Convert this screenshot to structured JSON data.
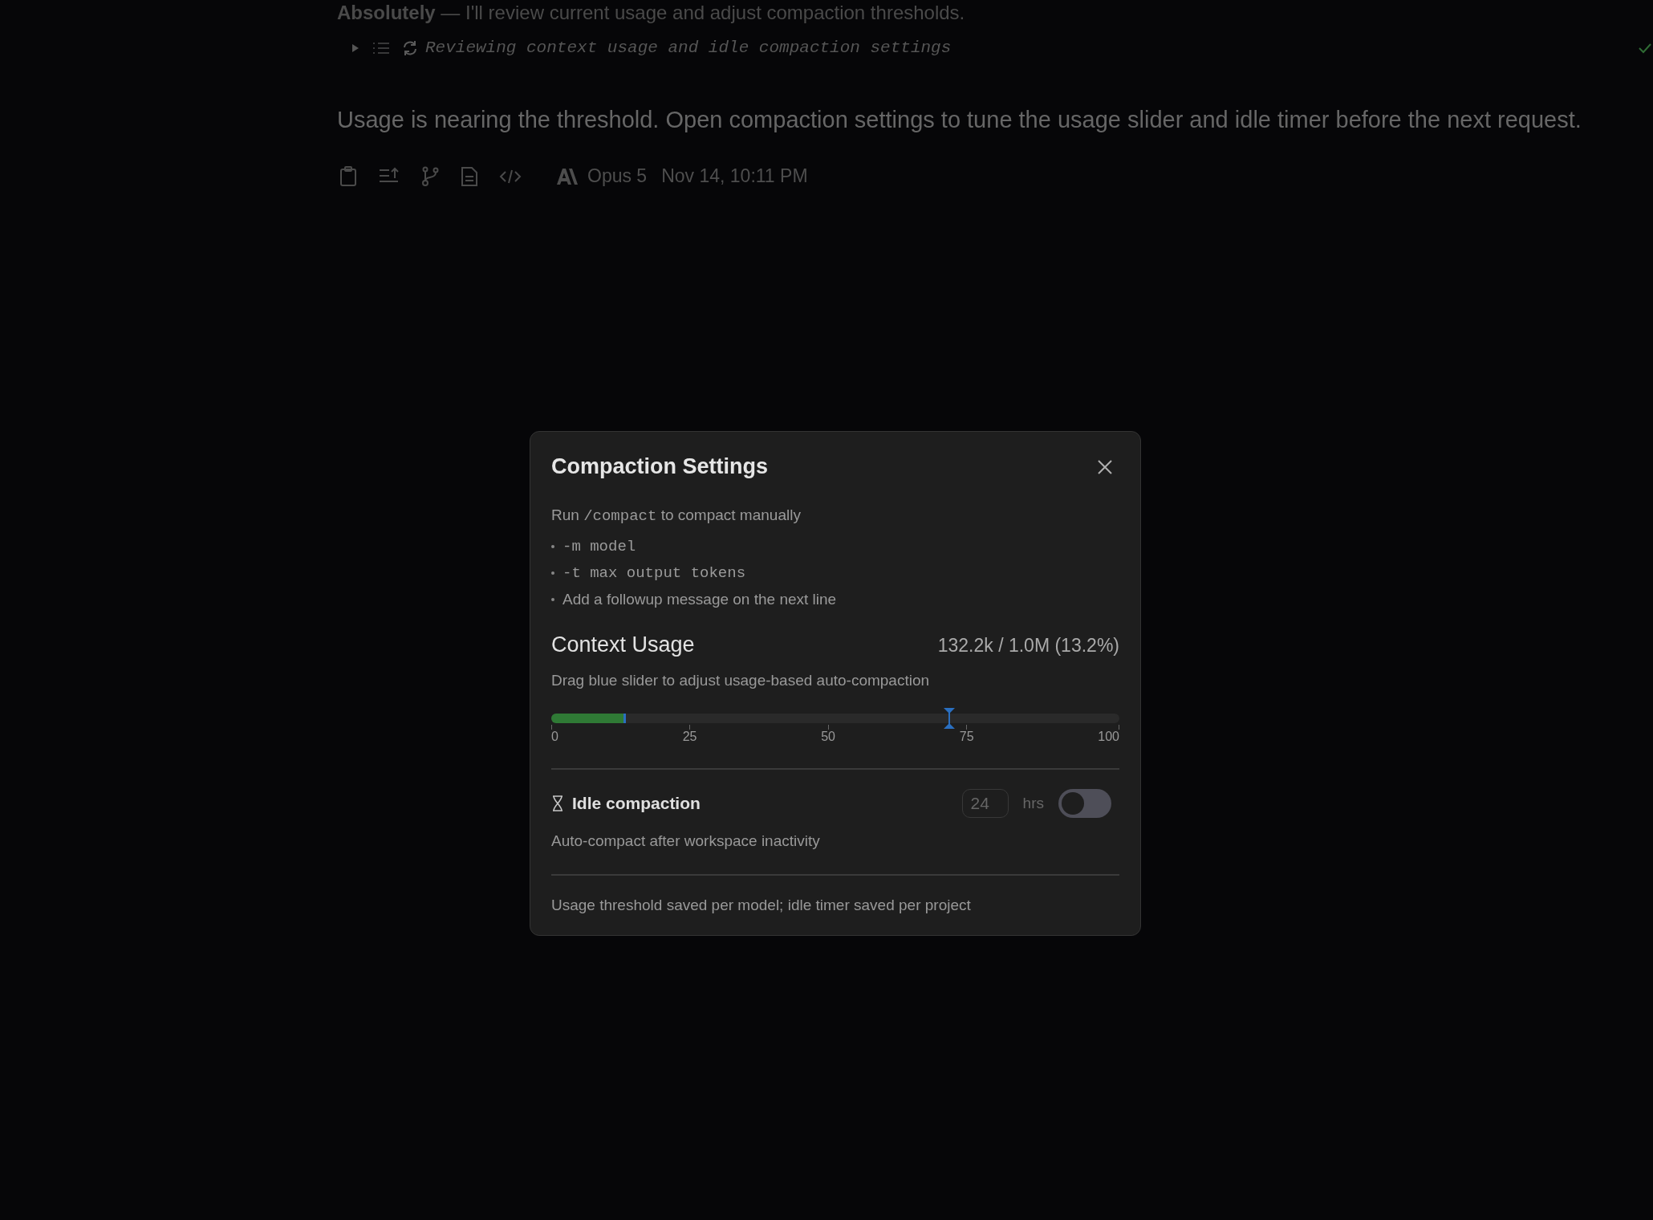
{
  "message": {
    "intro": "**Absolutely** — I'll review current usage and adjust compaction thresholds.",
    "tool_call": {
      "label": "Reviewing context usage and idle compaction settings",
      "expanded": false,
      "done": true
    },
    "reply": "Usage is nearing the threshold. Open compaction settings to tune the usage slider and idle timer before the next request.",
    "meta": {
      "model": "Opus 5",
      "time": "Nov 14, 10:11 PM"
    }
  },
  "dialog": {
    "title": "Compaction Settings",
    "command_hint": [
      {
        "text": "Run ",
        "kind": "plain"
      },
      {
        "text": "/compact",
        "kind": "code"
      },
      {
        "text": " to compact manually",
        "kind": "plain"
      }
    ],
    "options": [
      {
        "text": "-m model",
        "kind": "code"
      },
      {
        "text": "-t max output tokens",
        "kind": "code"
      },
      {
        "text": "Add a followup message on the next line",
        "kind": "plain"
      }
    ],
    "usage": {
      "title": "Context Usage",
      "reading": "132.2k / 1.0M (13.2%)",
      "hint": "Drag blue slider to adjust usage-based auto-compaction",
      "level": 0.132,
      "threshold": {
        "level": 0.7
      },
      "ticks": [
        "0",
        "25",
        "50",
        "75",
        "100"
      ]
    },
    "idle": {
      "title": "Idle compaction",
      "value": "24",
      "unit": "hrs",
      "on": false,
      "description": "Auto-compact after workspace inactivity"
    },
    "footer": "Usage threshold saved per model; idle timer saved per project"
  }
}
